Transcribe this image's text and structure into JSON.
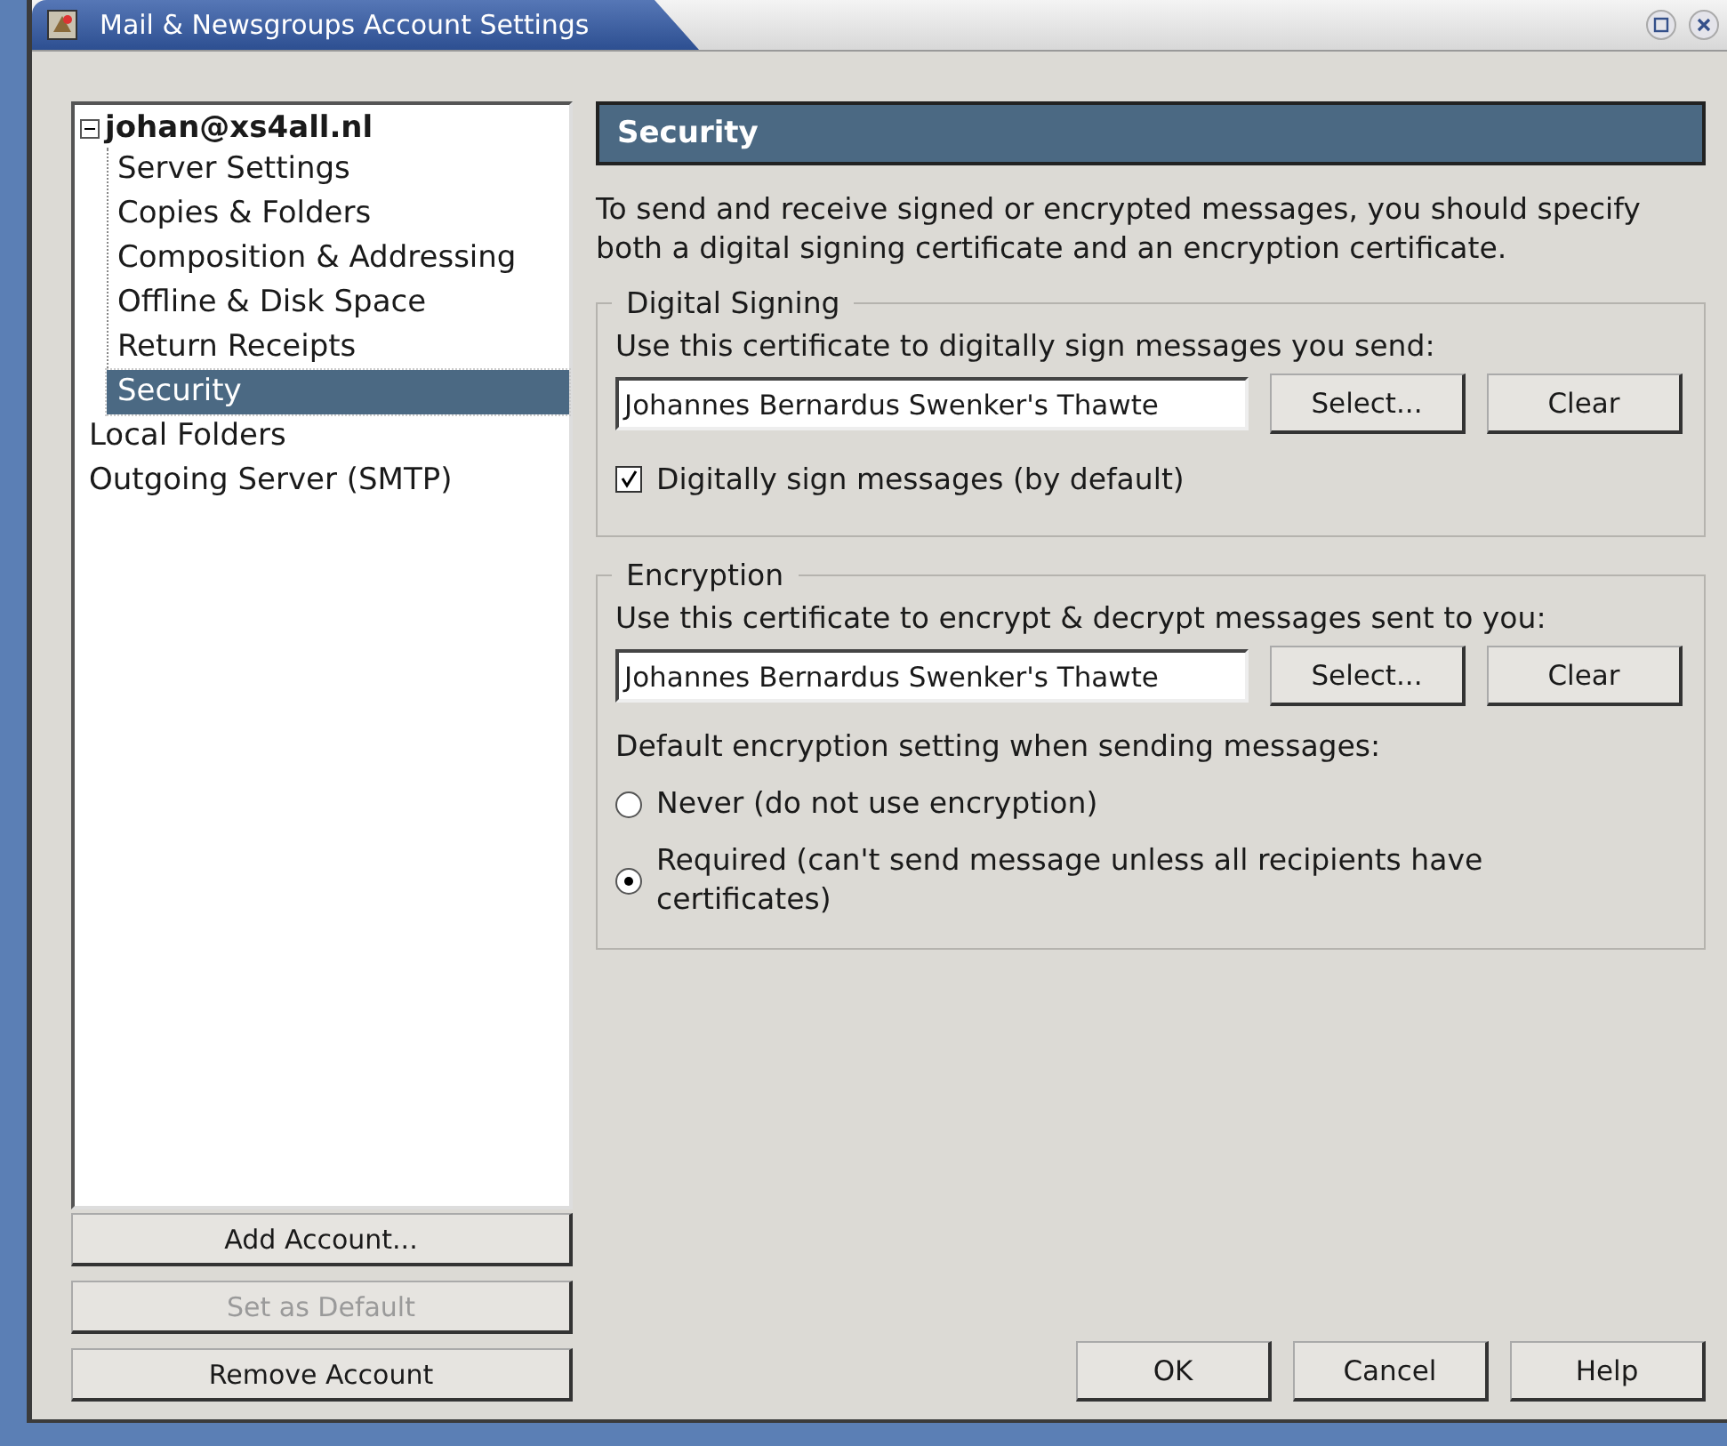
{
  "window": {
    "title": "Mail & Newsgroups Account Settings"
  },
  "tree": [
    {
      "label": "johan@xs4all.nl",
      "expanded": true,
      "selected": false,
      "children": [
        {
          "label": "Server Settings",
          "selected": false
        },
        {
          "label": "Copies & Folders",
          "selected": false
        },
        {
          "label": "Composition & Addressing",
          "selected": false
        },
        {
          "label": "Offline & Disk Space",
          "selected": false
        },
        {
          "label": "Return Receipts",
          "selected": false
        },
        {
          "label": "Security",
          "selected": true
        }
      ]
    },
    {
      "label": "Local Folders",
      "selected": false
    },
    {
      "label": "Outgoing Server (SMTP)",
      "selected": false
    }
  ],
  "account_buttons": [
    {
      "label": "Add Account...",
      "disabled": false
    },
    {
      "label": "Set as Default",
      "disabled": true
    },
    {
      "label": "Remove Account",
      "disabled": false
    }
  ],
  "page": {
    "title": "Security",
    "intro": "To send and receive signed or encrypted messages, you should specify both a digital signing certificate and an encryption certificate."
  },
  "digital_signing": {
    "legend": "Digital Signing",
    "prompt": "Use this certificate to digitally sign messages you send:",
    "certificate": "Johannes Bernardus Swenker's Thawte",
    "buttons": [
      "Select...",
      "Clear"
    ],
    "checkbox": {
      "label": "Digitally sign messages (by default)",
      "checked": true
    }
  },
  "encryption": {
    "legend": "Encryption",
    "prompt": "Use this certificate to encrypt & decrypt messages sent to you:",
    "certificate": "Johannes Bernardus Swenker's Thawte",
    "buttons": [
      "Select...",
      "Clear"
    ],
    "setting_label": "Default encryption setting when sending messages:",
    "options": [
      {
        "label": "Never (do not use encryption)",
        "selected": false
      },
      {
        "label": "Required (can't send message unless all recipients have certificates)",
        "selected": true
      }
    ]
  },
  "dialog_buttons": [
    "OK",
    "Cancel",
    "Help"
  ]
}
